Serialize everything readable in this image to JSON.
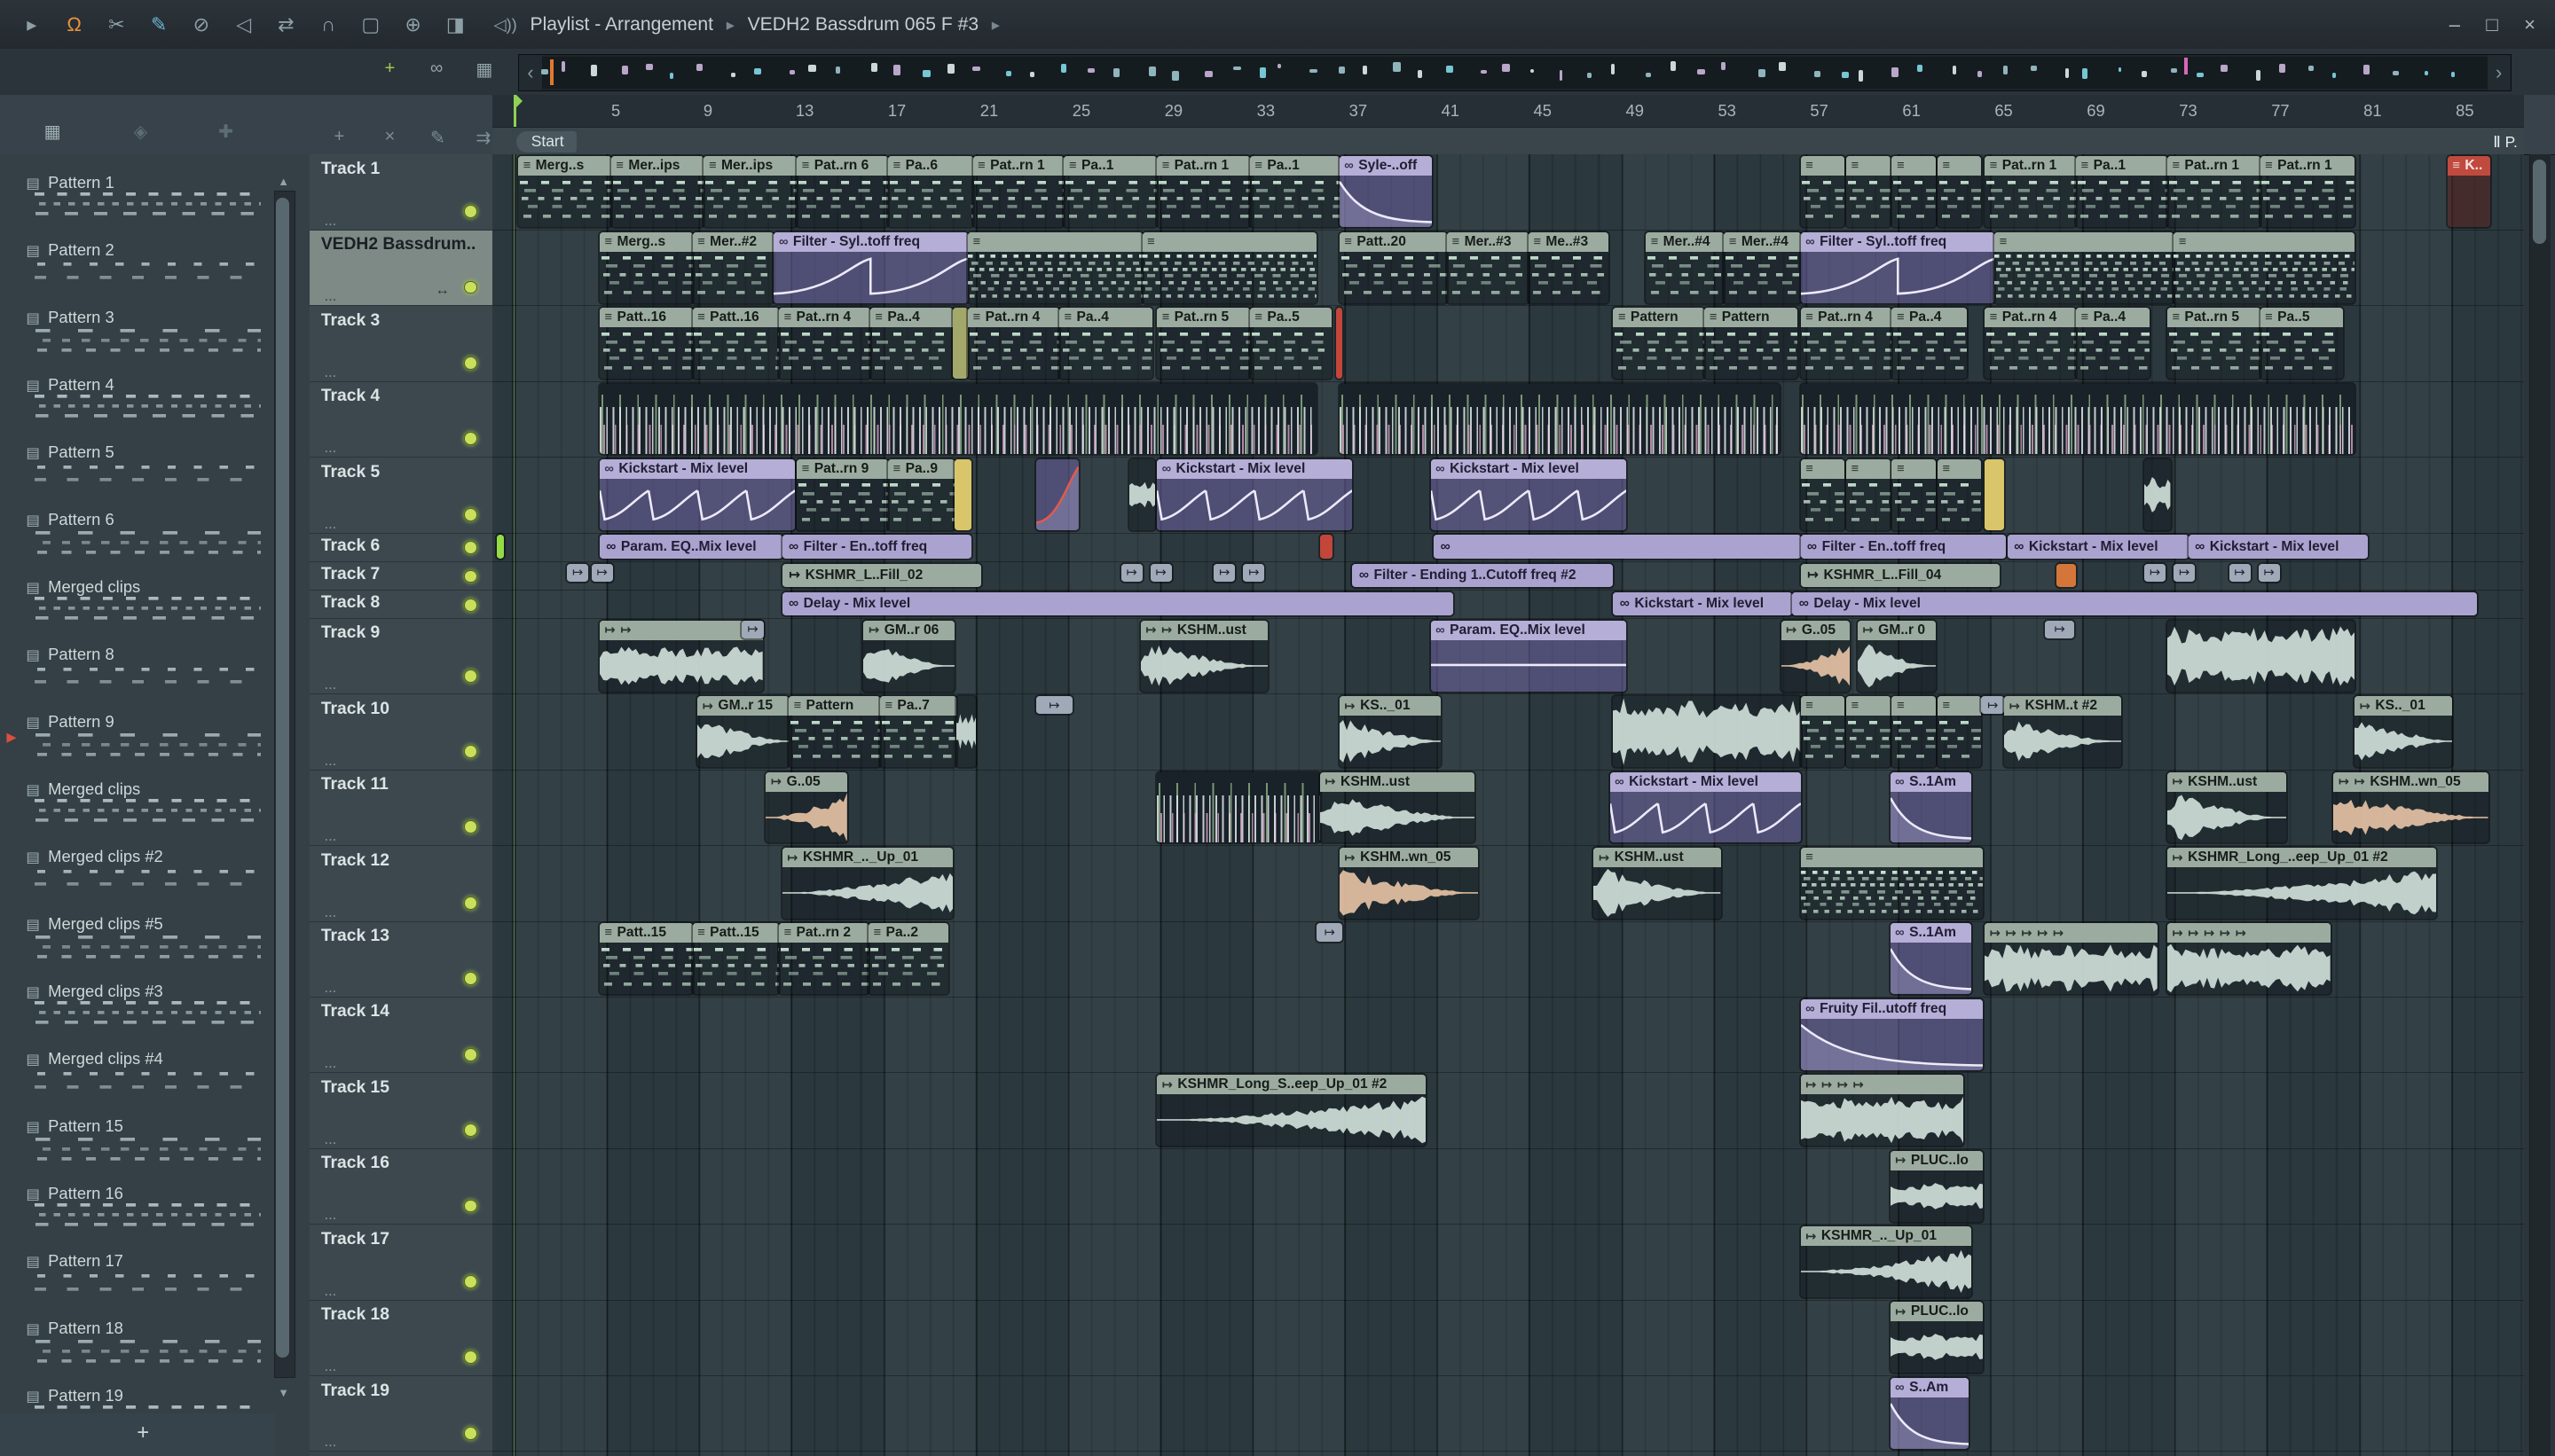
{
  "titlebar": {
    "breadcrumb": [
      "Playlist - Arrangement",
      "VEDH2 Bassdrum 065 F #3"
    ],
    "separator": "▸",
    "speaker_icon": "◁))",
    "window": {
      "minimize": "–",
      "maximize": "□",
      "close": "×"
    },
    "left_icons": [
      {
        "name": "play-icon",
        "glyph": "▸"
      },
      {
        "name": "fl-logo-icon",
        "glyph": "Ω",
        "color": "#e8913f"
      },
      {
        "name": "cut-tool-icon",
        "glyph": "✂"
      },
      {
        "name": "draw-tool-icon",
        "glyph": "✎",
        "color": "#6fb3d2"
      },
      {
        "name": "disable-tool-icon",
        "glyph": "⊘"
      },
      {
        "name": "mute-tool-icon",
        "glyph": "◁"
      },
      {
        "name": "swap-tool-icon",
        "glyph": "⇄"
      },
      {
        "name": "snap-magnet-icon",
        "glyph": "∩"
      },
      {
        "name": "select-tool-icon",
        "glyph": "▢"
      },
      {
        "name": "zoom-tool-icon",
        "glyph": "⊕"
      },
      {
        "name": "monitor-icon",
        "glyph": "◨"
      }
    ]
  },
  "playlist_toolbar": {
    "overview_left_arrow": "‹",
    "overview_right_arrow": "›",
    "row1_icons": [
      {
        "name": "slide-tool-icon",
        "glyph": "+",
        "color": "#9ec84f"
      },
      {
        "name": "link-tool-icon",
        "glyph": "∞"
      },
      {
        "name": "grid-tool-icon",
        "glyph": "▦"
      }
    ],
    "row2_icons": [
      {
        "name": "add-icon",
        "glyph": "+"
      },
      {
        "name": "delete-icon",
        "glyph": "×"
      },
      {
        "name": "pencil-icon",
        "glyph": "✎"
      },
      {
        "name": "send-icon",
        "glyph": "⇉"
      }
    ],
    "sidebar_header_icons": [
      {
        "name": "pattern-grid-icon",
        "glyph": "▦"
      },
      {
        "name": "diamond-icon",
        "glyph": "◈"
      },
      {
        "name": "plus-deco-icon",
        "glyph": "✚"
      }
    ]
  },
  "ruler": {
    "numbers": [
      5,
      9,
      13,
      17,
      21,
      25,
      29,
      33,
      37,
      41,
      45,
      49,
      53,
      57,
      61,
      65,
      69,
      73,
      77,
      81,
      85
    ],
    "start_marker": "Start",
    "right_marker": "Ⅱ P."
  },
  "sidebar": {
    "add_button": "+",
    "marker_index": 8,
    "patterns": [
      {
        "name": "Pattern 1"
      },
      {
        "name": "Pattern 2"
      },
      {
        "name": "Pattern 3"
      },
      {
        "name": "Pattern 4"
      },
      {
        "name": "Pattern 5"
      },
      {
        "name": "Pattern 6"
      },
      {
        "name": "Merged clips"
      },
      {
        "name": "Pattern 8"
      },
      {
        "name": "Pattern 9"
      },
      {
        "name": "Merged clips"
      },
      {
        "name": "Merged clips #2"
      },
      {
        "name": "Merged clips #5"
      },
      {
        "name": "Merged clips #3"
      },
      {
        "name": "Merged clips #4"
      },
      {
        "name": "Pattern 15"
      },
      {
        "name": "Pattern 16"
      },
      {
        "name": "Pattern 17"
      },
      {
        "name": "Pattern 18"
      },
      {
        "name": "Pattern 19"
      }
    ]
  },
  "tracks": [
    {
      "name": "Track 1",
      "kind": "tall",
      "clips": [
        [
          318,
          57,
          "m",
          "Merg..s"
        ],
        [
          375,
          57,
          "m",
          "Mer..ips"
        ],
        [
          432,
          57,
          "m",
          "Mer..ips"
        ],
        [
          489,
          56,
          "m",
          "Pat..rn 6"
        ],
        [
          545,
          52,
          "m",
          "Pa..6"
        ],
        [
          597,
          56,
          "m",
          "Pat..rn 1"
        ],
        [
          653,
          57,
          "m",
          "Pa..1"
        ],
        [
          710,
          57,
          "m",
          "Pat..rn 1"
        ],
        [
          767,
          55,
          "m",
          "Pa..1"
        ],
        [
          822,
          57,
          "au",
          "Syle-..off",
          "fall"
        ],
        [
          1105,
          27,
          "m",
          ""
        ],
        [
          1133,
          27,
          "m",
          ""
        ],
        [
          1161,
          27,
          "m",
          ""
        ],
        [
          1189,
          27,
          "m",
          ""
        ],
        [
          1218,
          56,
          "m",
          "Pat..rn 1"
        ],
        [
          1274,
          56,
          "m",
          "Pa..1"
        ],
        [
          1330,
          57,
          "m",
          "Pat..rn 1"
        ],
        [
          1387,
          58,
          "m",
          "Pat..rn 1"
        ],
        [
          1502,
          26,
          "r",
          "K.."
        ]
      ]
    },
    {
      "name": "VEDH2 Bassdrum..",
      "kind": "tall",
      "selected": true,
      "clips": [
        [
          368,
          57,
          "m",
          "Merg..s"
        ],
        [
          425,
          50,
          "m",
          "Mer..#2"
        ],
        [
          475,
          119,
          "au",
          "Filter - Syl..toff freq",
          "sweep"
        ],
        [
          594,
          107,
          "md",
          ""
        ],
        [
          701,
          107,
          "md",
          ""
        ],
        [
          822,
          66,
          "m",
          "Patt..20"
        ],
        [
          888,
          50,
          "m",
          "Mer..#3"
        ],
        [
          938,
          49,
          "m",
          "Me..#3"
        ],
        [
          1010,
          48,
          "m",
          "Mer..#4"
        ],
        [
          1058,
          47,
          "m",
          "Mer..#4"
        ],
        [
          1105,
          119,
          "au",
          "Filter - Syl..toff freq",
          "sweep"
        ],
        [
          1224,
          110,
          "md",
          ""
        ],
        [
          1334,
          111,
          "md",
          ""
        ]
      ]
    },
    {
      "name": "Track 3",
      "kind": "tall",
      "clips": [
        [
          368,
          57,
          "m",
          "Patt..16"
        ],
        [
          425,
          53,
          "m",
          "Patt..16"
        ],
        [
          478,
          56,
          "m",
          "Pat..rn 4"
        ],
        [
          534,
          51,
          "m",
          "Pa..4"
        ],
        [
          585,
          9,
          "sl",
          "",
          "",
          "olive"
        ],
        [
          594,
          56,
          "m",
          "Pat..rn 4"
        ],
        [
          650,
          57,
          "m",
          "Pa..4"
        ],
        [
          710,
          57,
          "m",
          "Pat..rn 5"
        ],
        [
          767,
          50,
          "m",
          "Pa..5"
        ],
        [
          820,
          4,
          "sl",
          "",
          "",
          "red"
        ],
        [
          990,
          56,
          "m",
          "Pattern"
        ],
        [
          1046,
          57,
          "m",
          "Pattern"
        ],
        [
          1105,
          56,
          "m",
          "Pat..rn 4"
        ],
        [
          1161,
          46,
          "m",
          "Pa..4"
        ],
        [
          1218,
          56,
          "m",
          "Pat..rn 4"
        ],
        [
          1274,
          45,
          "m",
          "Pa..4"
        ],
        [
          1330,
          57,
          "m",
          "Pat..rn 5"
        ],
        [
          1387,
          51,
          "m",
          "Pa..5"
        ]
      ]
    },
    {
      "name": "Track 4",
      "kind": "tall",
      "clips": [
        [
          368,
          440,
          "st"
        ],
        [
          822,
          270,
          "st"
        ],
        [
          1105,
          340,
          "st"
        ]
      ]
    },
    {
      "name": "Track 5",
      "kind": "tall",
      "clips": [
        [
          368,
          120,
          "au",
          "Kickstart - Mix level",
          "saw"
        ],
        [
          489,
          56,
          "m",
          "Pat..rn 9"
        ],
        [
          545,
          41,
          "m",
          "Pa..9"
        ],
        [
          586,
          10,
          "sl",
          "",
          "",
          "yellow"
        ],
        [
          636,
          26,
          "au",
          "",
          "rise",
          "red"
        ],
        [
          693,
          16,
          "a",
          "",
          "small"
        ],
        [
          710,
          120,
          "au",
          "Kickstart - Mix level",
          "saw"
        ],
        [
          878,
          120,
          "au",
          "Kickstart - Mix level",
          "saw"
        ],
        [
          1105,
          27,
          "m",
          ""
        ],
        [
          1133,
          27,
          "m",
          ""
        ],
        [
          1161,
          27,
          "m",
          ""
        ],
        [
          1189,
          27,
          "m",
          ""
        ],
        [
          1218,
          12,
          "sl",
          "",
          "",
          "yellow"
        ],
        [
          1316,
          16,
          "a",
          "",
          "small"
        ]
      ]
    },
    {
      "name": "Track 6",
      "kind": "compact",
      "clips": [
        [
          305,
          4,
          "sl",
          "",
          "",
          "lime"
        ],
        [
          368,
          112,
          "as",
          "Param. EQ..Mix level"
        ],
        [
          480,
          116,
          "as",
          "Filter - En..toff freq"
        ],
        [
          810,
          8,
          "sl",
          "",
          "",
          "red"
        ],
        [
          880,
          225,
          "as",
          ""
        ],
        [
          1105,
          126,
          "as",
          "Filter - En..toff freq"
        ],
        [
          1232,
          111,
          "as",
          "Kickstart - Mix level"
        ],
        [
          1343,
          110,
          "as",
          "Kickstart - Mix level"
        ]
      ]
    },
    {
      "name": "Track 7",
      "kind": "compact",
      "clips": [
        [
          348,
          13,
          "i"
        ],
        [
          363,
          13,
          "i"
        ],
        [
          480,
          122,
          "gs",
          "KSHMR_L..Fill_02"
        ],
        [
          688,
          13,
          "i"
        ],
        [
          706,
          13,
          "i"
        ],
        [
          745,
          13,
          "i"
        ],
        [
          763,
          13,
          "i"
        ],
        [
          830,
          160,
          "as",
          "Filter - Ending 1..Cutoff freq #2"
        ],
        [
          1105,
          122,
          "gs",
          "KSHMR_L..Fill_04"
        ],
        [
          1262,
          12,
          "sl",
          "",
          "",
          "orange"
        ],
        [
          1316,
          13,
          "i"
        ],
        [
          1334,
          13,
          "i"
        ],
        [
          1368,
          13,
          "i"
        ],
        [
          1386,
          13,
          "i"
        ]
      ]
    },
    {
      "name": "Track 8",
      "kind": "compact",
      "clips": [
        [
          480,
          412,
          "as",
          "Delay - Mix level"
        ],
        [
          990,
          110,
          "as",
          "Kickstart - Mix level"
        ],
        [
          1100,
          420,
          "as",
          "Delay - Mix level"
        ]
      ]
    },
    {
      "name": "Track 9",
      "kind": "tall",
      "clips": [
        [
          368,
          100,
          "a",
          "",
          "steady",
          "",
          2
        ],
        [
          455,
          14,
          "i"
        ],
        [
          530,
          56,
          "a",
          "GM..r 06",
          "burst",
          "",
          1
        ],
        [
          700,
          78,
          "a",
          "KSHM..ust",
          "burst",
          "",
          2
        ],
        [
          878,
          120,
          "au",
          "Param. EQ..Mix level",
          "flat"
        ],
        [
          1093,
          42,
          "a",
          "G..05",
          "swell",
          "peach",
          1
        ],
        [
          1140,
          48,
          "a",
          "GM..r 0",
          "burst",
          "",
          1
        ],
        [
          1255,
          18,
          "i"
        ],
        [
          1330,
          115,
          "a",
          "",
          "dense"
        ]
      ]
    },
    {
      "name": "Track 10",
      "kind": "tall",
      "clips": [
        [
          428,
          56,
          "a",
          "GM..r 15",
          "decay",
          "",
          1
        ],
        [
          484,
          56,
          "m",
          "Pattern"
        ],
        [
          540,
          47,
          "m",
          "Pa..7"
        ],
        [
          587,
          12,
          "a",
          "",
          "small"
        ],
        [
          636,
          22,
          "i"
        ],
        [
          822,
          62,
          "a",
          "KS.._01",
          "decay",
          "",
          1
        ],
        [
          990,
          115,
          "a",
          "",
          "dense"
        ],
        [
          1105,
          27,
          "m",
          ""
        ],
        [
          1133,
          27,
          "m",
          ""
        ],
        [
          1161,
          27,
          "m",
          ""
        ],
        [
          1189,
          27,
          "m",
          ""
        ],
        [
          1216,
          14,
          "i"
        ],
        [
          1230,
          72,
          "a",
          "KSHM..t #2",
          "burst",
          "",
          1
        ],
        [
          1445,
          60,
          "a",
          "KS.._01",
          "decay",
          "",
          1
        ]
      ]
    },
    {
      "name": "Track 11",
      "kind": "tall",
      "clips": [
        [
          470,
          50,
          "a",
          "G..05",
          "swell",
          "peach",
          1
        ],
        [
          710,
          100,
          "st"
        ],
        [
          810,
          95,
          "a",
          "KSHM..ust",
          "burst",
          "",
          1
        ],
        [
          988,
          117,
          "au",
          "Kickstart - Mix level",
          "saw"
        ],
        [
          1160,
          50,
          "au",
          "S..1Am",
          "fall",
          "purple"
        ],
        [
          1330,
          73,
          "a",
          "KSHM..ust",
          "burst",
          "",
          1
        ],
        [
          1432,
          95,
          "a",
          "KSHM..wn_05",
          "decay",
          "peach",
          2
        ]
      ]
    },
    {
      "name": "Track 12",
      "kind": "tall",
      "clips": [
        [
          480,
          105,
          "a",
          "KSHMR_.._Up_01",
          "swell",
          "",
          1
        ],
        [
          822,
          85,
          "a",
          "KSHM..wn_05",
          "decay",
          "peach",
          1
        ],
        [
          978,
          78,
          "a",
          "KSHM..ust",
          "burst",
          "",
          1
        ],
        [
          1105,
          112,
          "md",
          ""
        ],
        [
          1330,
          165,
          "a",
          "KSHMR_Long_..eep_Up_01 #2",
          "swell",
          "",
          1
        ]
      ]
    },
    {
      "name": "Track 13",
      "kind": "tall",
      "clips": [
        [
          368,
          57,
          "m",
          "Patt..15"
        ],
        [
          425,
          53,
          "m",
          "Patt..15"
        ],
        [
          478,
          55,
          "m",
          "Pat..rn 2"
        ],
        [
          533,
          49,
          "m",
          "Pa..2"
        ],
        [
          808,
          16,
          "i"
        ],
        [
          1160,
          50,
          "au",
          "S..1Am",
          "fall",
          "purple"
        ],
        [
          1218,
          106,
          "a",
          "",
          "dense",
          "",
          5
        ],
        [
          1330,
          100,
          "a",
          "",
          "dense",
          "",
          5
        ]
      ]
    },
    {
      "name": "Track 14",
      "kind": "tall",
      "clips": [
        [
          1105,
          112,
          "au",
          "Fruity Fil..utoff freq",
          "fall"
        ]
      ]
    },
    {
      "name": "Track 15",
      "kind": "tall",
      "clips": [
        [
          710,
          165,
          "a",
          "KSHMR_Long_S..eep_Up_01 #2",
          "swell",
          "",
          1
        ],
        [
          1105,
          100,
          "a",
          "",
          "dense",
          "",
          4
        ]
      ]
    },
    {
      "name": "Track 16",
      "kind": "tall",
      "clips": [
        [
          1160,
          57,
          "a",
          "PLUC..lo",
          "small",
          "",
          1
        ]
      ]
    },
    {
      "name": "Track 17",
      "kind": "tall",
      "clips": [
        [
          1105,
          105,
          "a",
          "KSHMR_.._Up_01",
          "swell",
          "",
          1
        ]
      ]
    },
    {
      "name": "Track 18",
      "kind": "tall",
      "clips": [
        [
          1160,
          57,
          "a",
          "PLUC..lo",
          "small",
          "",
          1
        ]
      ]
    },
    {
      "name": "Track 19",
      "kind": "tall",
      "clips": [
        [
          1160,
          48,
          "au",
          "S..Am",
          "fall",
          "purple"
        ]
      ]
    }
  ],
  "colors": {
    "accent_green": "#c8e05c",
    "automation_lavender": "#aaa3cf",
    "midi_header": "#9cab9f",
    "red_clip": "#c04a3e",
    "playhead_green": "#8ed253"
  }
}
